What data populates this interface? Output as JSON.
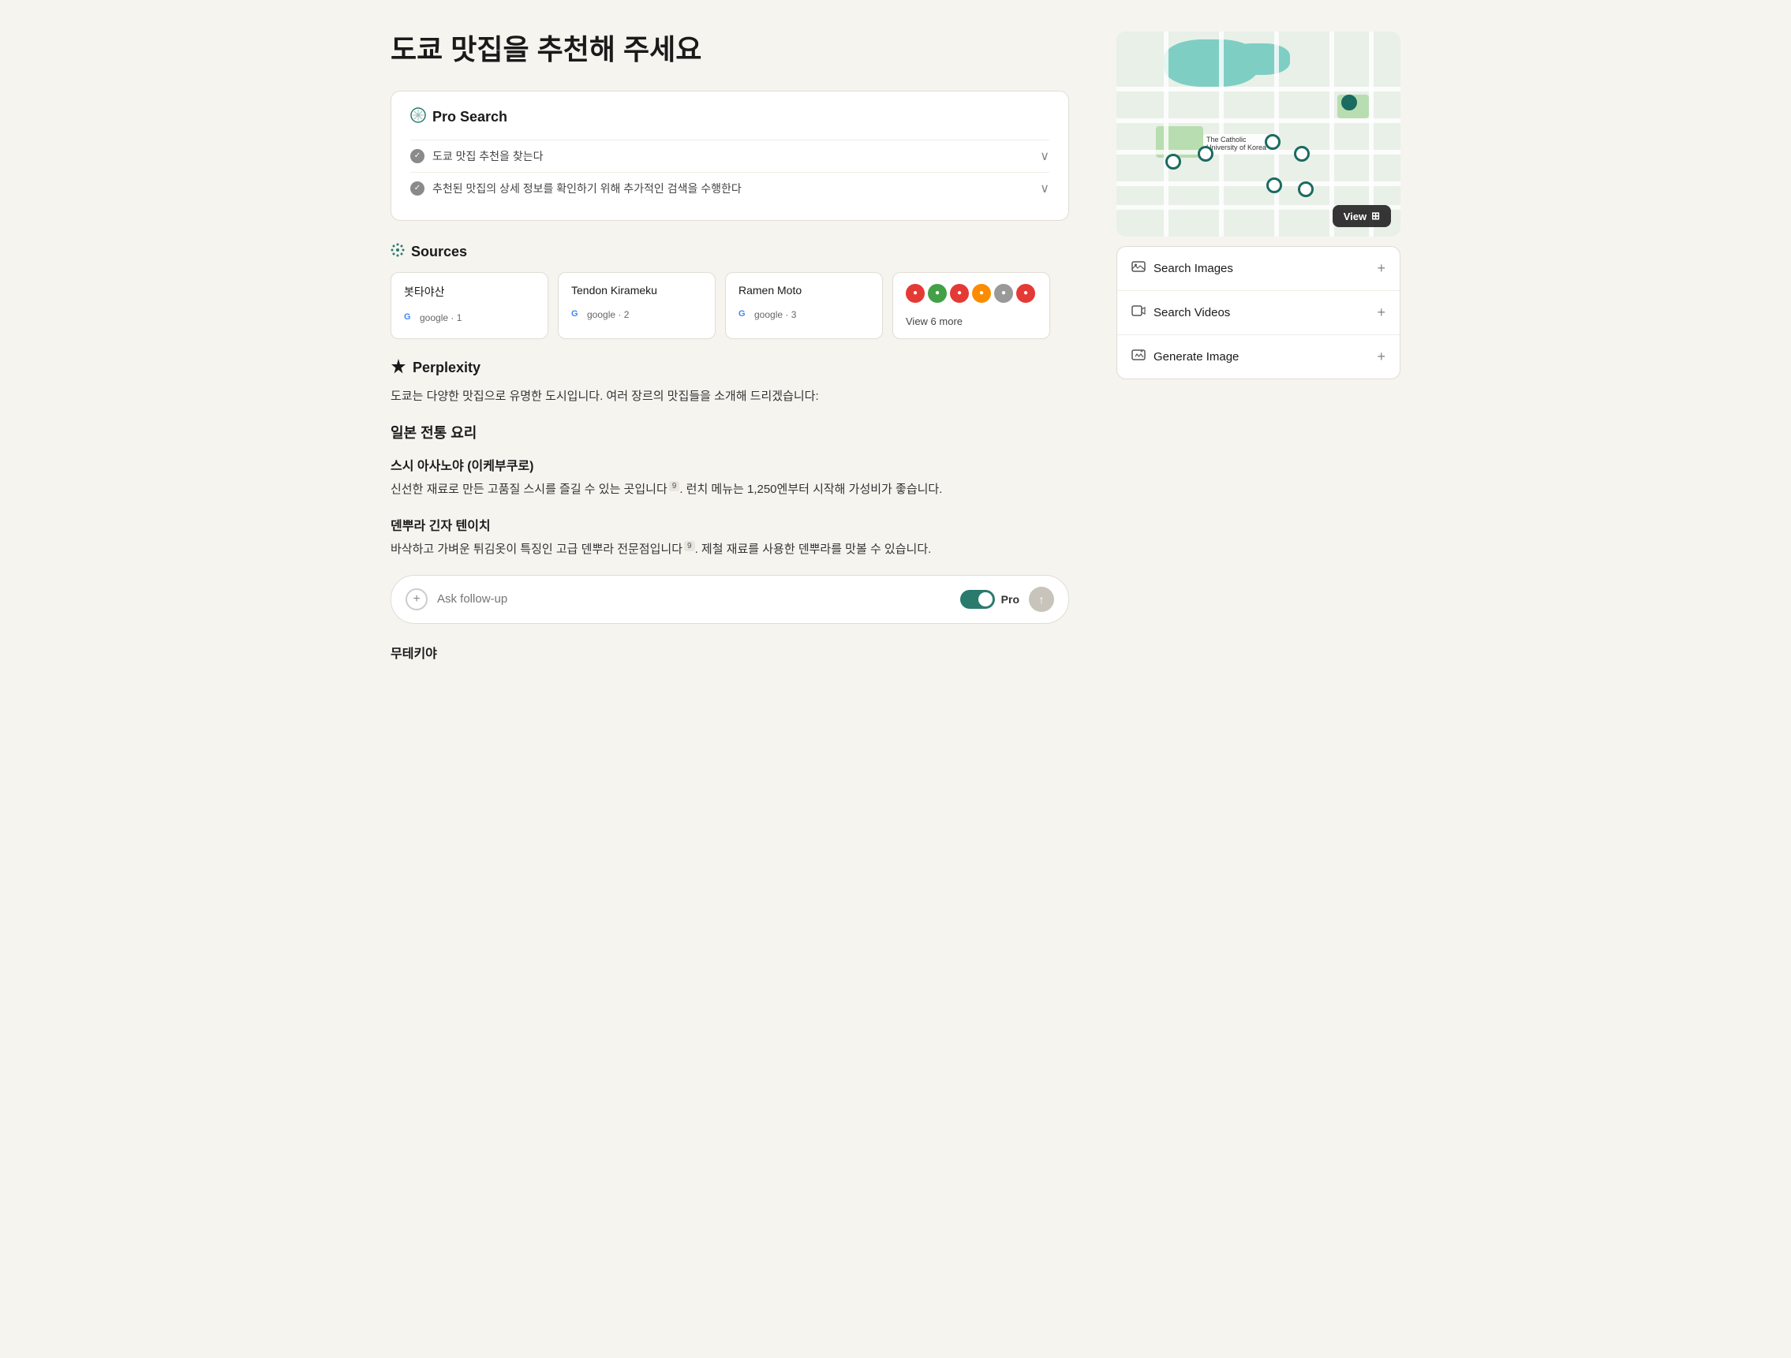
{
  "page": {
    "title": "도쿄 맛집을 추천해 주세요"
  },
  "pro_search": {
    "label": "Pro Search",
    "icon": "⊕",
    "steps": [
      {
        "text": "도쿄 맛집 추천을 찾는다"
      },
      {
        "text": "추천된 맛집의 상세 정보를 확인하기 위해 추가적인 검색을 수행한다"
      }
    ]
  },
  "sources": {
    "label": "Sources",
    "icon": "✦",
    "items": [
      {
        "name": "봇타야산",
        "provider": "google",
        "num": "1"
      },
      {
        "name": "Tendon Kirameku",
        "provider": "google",
        "num": "2"
      },
      {
        "name": "Ramen Moto",
        "provider": "google",
        "num": "3"
      }
    ],
    "more": {
      "count": "View 6 more",
      "colors": [
        "#e53935",
        "#43a047",
        "#e53935",
        "#fb8c00",
        "#aaa",
        "#e53935"
      ]
    }
  },
  "answer": {
    "brand": "Perplexity",
    "icon": "✳",
    "intro": "도쿄는 다양한 맛집으로 유명한 도시입니다. 여러 장르의 맛집들을 소개해 드리겠습니다:",
    "categories": [
      {
        "title": "일본 전통 요리",
        "restaurants": [
          {
            "name": "스시 아사노야 (이케부쿠로)",
            "desc": "신선한 재료로 만든 고품질 스시를 즐길 수 있는 곳입니다",
            "ref": "9",
            "desc2": ". 런치 메뉴는 1,250엔부터 시작해 가성비가 좋습니다."
          },
          {
            "name": "덴뿌라 긴자 텐이치",
            "desc": "바삭하고 가벼운 튀김옷이 특징인 고급 덴뿌라 전문점입니다",
            "ref": "9",
            "desc2": ". 제철 재료를 사용한 덴뿌라를 맛볼 수 있습니다."
          }
        ]
      }
    ],
    "next_category": "무테키야"
  },
  "followup": {
    "placeholder": "Ask follow-up",
    "pro_label": "Pro"
  },
  "sidebar": {
    "map": {
      "view_btn": "View"
    },
    "actions": [
      {
        "label": "Search Images",
        "icon": "🖼"
      },
      {
        "label": "Search Videos",
        "icon": "📹"
      },
      {
        "label": "Generate Image",
        "icon": "🖼"
      }
    ]
  }
}
